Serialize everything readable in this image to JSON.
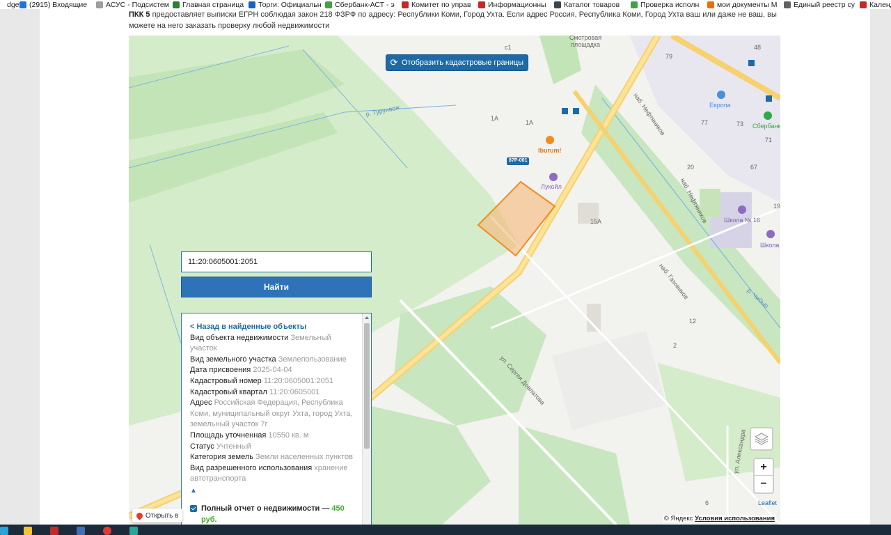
{
  "bookmarks": [
    {
      "label": "dget",
      "color": "#ffffff"
    },
    {
      "label": "(2915) Входящие",
      "color": "#1a73e8"
    },
    {
      "label": "АСУС - Подсистем",
      "color": "#9e9e9e"
    },
    {
      "label": "Главная страница",
      "color": "#2e7d32"
    },
    {
      "label": "Торги: Официальн",
      "color": "#1565c0"
    },
    {
      "label": "Сбербанк-АСТ - э",
      "color": "#43a047"
    },
    {
      "label": "Комитет по управ",
      "color": "#c62828"
    },
    {
      "label": "Информационны",
      "color": "#c62828"
    },
    {
      "label": "Каталог товаров",
      "color": "#37474f"
    },
    {
      "label": "Проверка исполн",
      "color": "#43a047"
    },
    {
      "label": "мои документы M",
      "color": "#ef6c00"
    },
    {
      "label": "Единый реестр су",
      "color": "#616161"
    },
    {
      "label": "Календ",
      "color": "#c62828"
    }
  ],
  "intro": {
    "brand": "ПКК 5",
    "text": " предоставляет выписки ЕГРН соблюдая закон 218 ФЗРФ по адресу: Республики Коми, Город Ухта. Если адрес Россия, Республика Коми, Город Ухта ваш или даже не ваш, вы можете на него заказать проверку любой недвижимости"
  },
  "map": {
    "cad_button": "Отобразить кадастровые границы",
    "labels": {
      "smotrovaya": "Смотровая площадка",
      "river": "р. Турунвож",
      "iburum": "Iburum!",
      "road": "87Р-001",
      "lukoil": "Лукойл",
      "evropa": "Европа",
      "sberbank": "Сбербанк",
      "school": "Школа № 16",
      "school2": "Школа",
      "neftyanikov1": "наб. Нефтяников",
      "neftyanikov2": "наб. Нефтяников",
      "gazovikov": "наб. Газовиков",
      "chibyu": "р. Чибью",
      "dovlatova": "ул. Сергея Довлатова",
      "alexandra": "ул. Александра",
      "n15a": "15А",
      "n1a": "1А",
      "n1a2": "1А",
      "n79": "79",
      "n77": "77",
      "n73": "73",
      "n71": "71",
      "n20": "20",
      "n67": "67",
      "n48": "48",
      "n12": "12",
      "n2": "2",
      "n6": "6",
      "n19": "19",
      "n_c1": "с1"
    },
    "colors": {
      "parcel_stroke": "#f08c1e",
      "parcel_fill": "#f7b77a",
      "road": "#f6d16d",
      "green": "#c8e6bf",
      "water": "#7fb6e0"
    }
  },
  "search": {
    "value": "11:20:0605001:2051",
    "button": "Найти"
  },
  "info": {
    "back": "< Назад в найденные объекты",
    "rows": [
      {
        "label": "Вид объекта недвижимости",
        "value": "Земельный участок"
      },
      {
        "label": "Вид земельного участка",
        "value": "Землепользование"
      },
      {
        "label": "Дата присвоения",
        "value": "2025-04-04"
      },
      {
        "label": "Кадастровый номер",
        "value": "11:20:0605001:2051"
      },
      {
        "label": "Кадастровый квартал",
        "value": "11:20:0605001"
      },
      {
        "label": "Адрес",
        "value": "Российская Федерация, Республика Коми, муниципальный округ Ухта, город Ухта, земельный участок 7г"
      },
      {
        "label": "Площадь уточненная",
        "value": "10550 кв. м"
      },
      {
        "label": "Статус",
        "value": "Учтенный"
      },
      {
        "label": "Категория земель",
        "value": "Земли населенных пунктов"
      },
      {
        "label": "Вид разрешенного использования",
        "value": "хранение автотранспорта"
      }
    ],
    "collapse": "▲",
    "report_label": "Полный отчет о недвижимости — ",
    "report_price": "450 руб."
  },
  "controls": {
    "open_in": "Открыть в",
    "zoom_in": "+",
    "zoom_out": "−",
    "leaflet": "Leaflet",
    "copyright": "© Яндекс ",
    "terms": "Условия использования"
  }
}
